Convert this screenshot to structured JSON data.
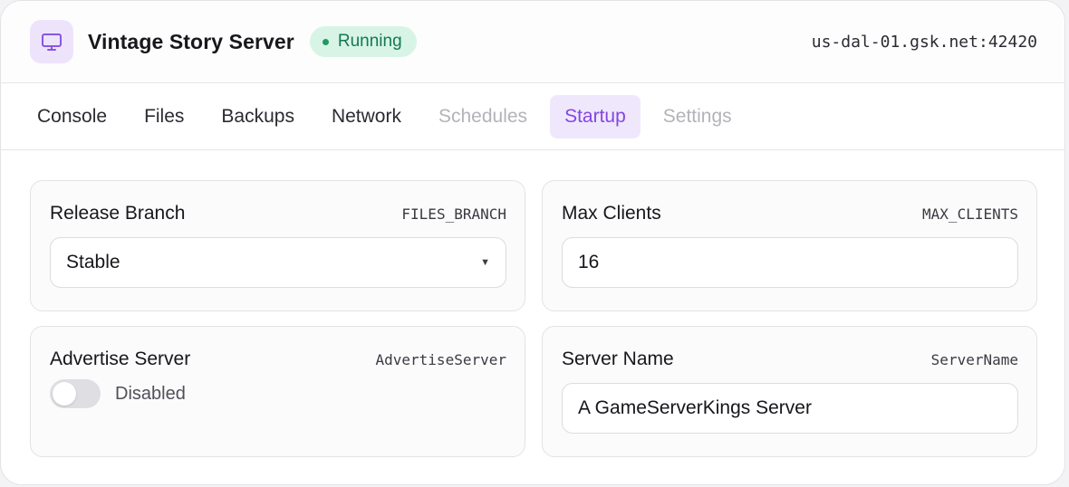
{
  "header": {
    "title": "Vintage Story Server",
    "status": "Running",
    "address": "us-dal-01.gsk.net:42420",
    "icon": "monitor-icon"
  },
  "tabs": [
    {
      "label": "Console",
      "state": "normal"
    },
    {
      "label": "Files",
      "state": "normal"
    },
    {
      "label": "Backups",
      "state": "normal"
    },
    {
      "label": "Network",
      "state": "normal"
    },
    {
      "label": "Schedules",
      "state": "disabled"
    },
    {
      "label": "Startup",
      "state": "active"
    },
    {
      "label": "Settings",
      "state": "disabled"
    }
  ],
  "variables": {
    "release_branch": {
      "label": "Release Branch",
      "var": "FILES_BRANCH",
      "value": "Stable"
    },
    "max_clients": {
      "label": "Max Clients",
      "var": "MAX_CLIENTS",
      "value": "16"
    },
    "advertise_server": {
      "label": "Advertise Server",
      "var": "AdvertiseServer",
      "toggle_label": "Disabled",
      "enabled": false
    },
    "server_name": {
      "label": "Server Name",
      "var": "ServerName",
      "value": "A GameServerKings Server"
    }
  },
  "colors": {
    "accent": "#8447e0",
    "status_bg": "#d8f4e6",
    "status_fg": "#137a4f"
  }
}
